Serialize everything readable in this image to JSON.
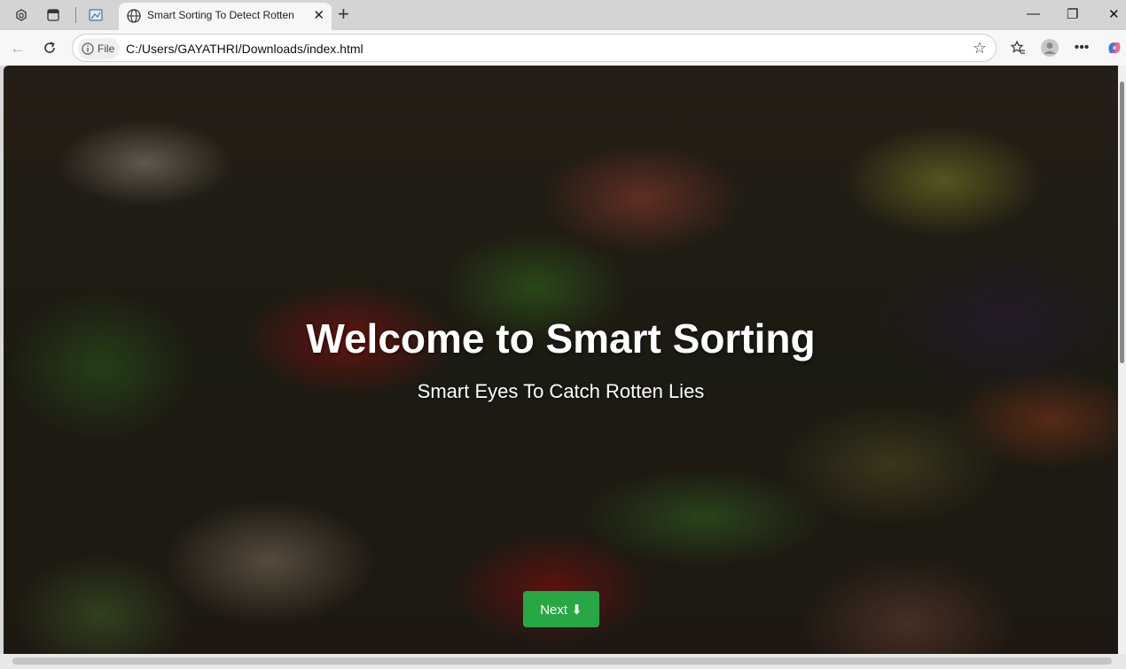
{
  "browser": {
    "tab": {
      "title": "Smart Sorting To Detect Rotten",
      "close": "✕"
    },
    "new_tab": "+",
    "window_controls": {
      "minimize": "—",
      "restore": "❐",
      "close": "✕"
    },
    "address": {
      "chip_label": "File",
      "url": "C:/Users/GAYATHRI/Downloads/index.html"
    }
  },
  "hero": {
    "title": "Welcome to Smart Sorting",
    "subtitle": "Smart Eyes To Catch Rotten Lies",
    "next_button": "Next ⬇"
  },
  "colors": {
    "accent_button": "#28a745",
    "titlebar": "#d4d4d4",
    "toolbar": "#f7f7f7"
  },
  "icons": [
    "workspaces-icon",
    "tab-actions-icon",
    "app-icon",
    "globe-icon",
    "back-icon",
    "refresh-icon",
    "info-icon",
    "favorite-star-icon",
    "favorites-icon",
    "profile-icon",
    "more-icon",
    "copilot-icon"
  ]
}
